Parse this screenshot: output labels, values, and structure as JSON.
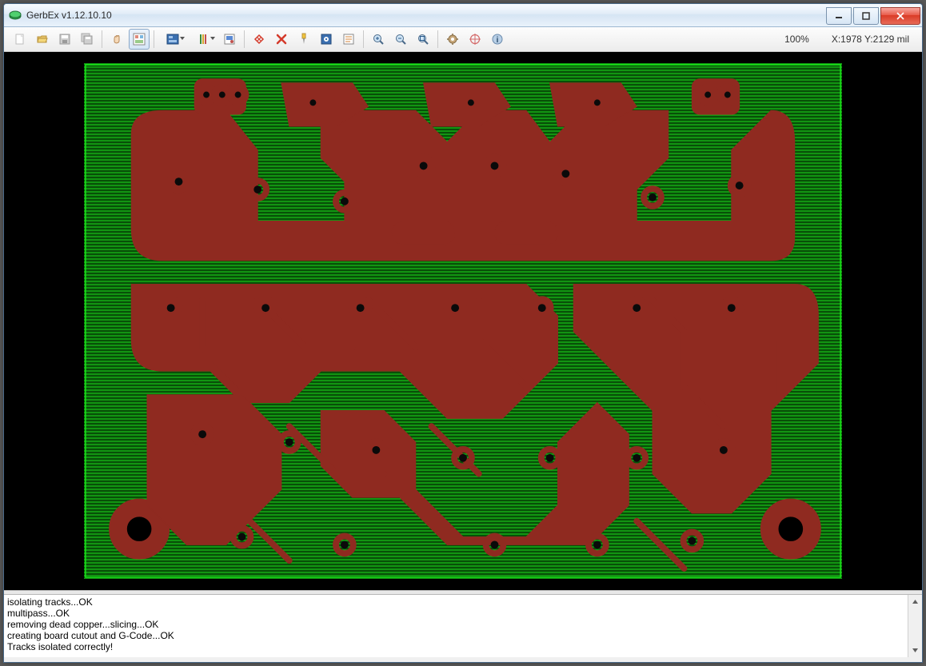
{
  "window": {
    "title": "GerbEx v1.12.10.10"
  },
  "toolbar": {
    "zoom_label": "100%",
    "coord_label": "X:1978 Y:2129 mil"
  },
  "log": {
    "lines": [
      "isolating tracks...OK",
      "multipass...OK",
      "removing dead copper...slicing...OK",
      "creating board cutout and G-Code...OK",
      "Tracks isolated correctly!"
    ]
  },
  "colors": {
    "copper": "#8f2a20",
    "board_green": "#0aa60a",
    "board_dark": "#063f06"
  }
}
